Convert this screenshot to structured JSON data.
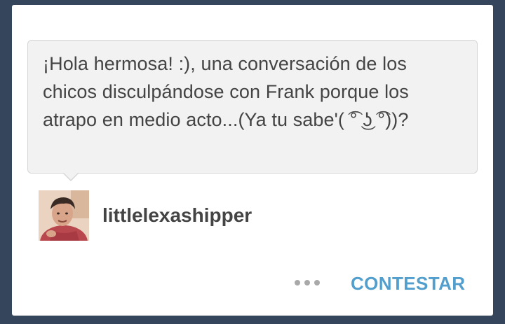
{
  "question": {
    "text": "¡Hola hermosa! :), una conversación de los chicos disculpándose con Frank porque los atrapo en medio acto...(Ya tu sabe'( ͡° ͜ʖ ͡°))?"
  },
  "asker": {
    "username": "littlelexashipper",
    "avatar_icon": "user-avatar"
  },
  "actions": {
    "more_icon": "ellipsis-icon",
    "reply_label": "CONTESTAR"
  },
  "colors": {
    "background": "#35465c",
    "card": "#ffffff",
    "bubble": "#f2f2f2",
    "text": "#444444",
    "accent": "#529ecc",
    "dots": "#a9a9a9"
  }
}
